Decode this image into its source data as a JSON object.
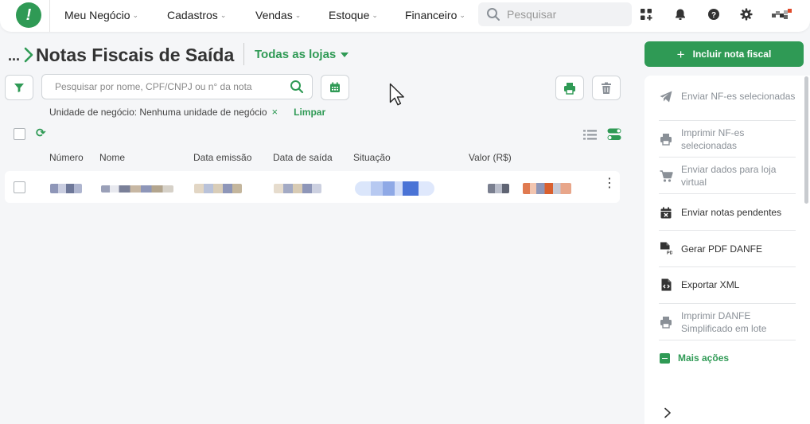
{
  "nav": {
    "items": [
      {
        "label": "Meu Negócio"
      },
      {
        "label": "Cadastros"
      },
      {
        "label": "Vendas"
      },
      {
        "label": "Estoque"
      },
      {
        "label": "Financeiro"
      }
    ],
    "search_placeholder": "Pesquisar"
  },
  "page": {
    "breadcrumb_dots": "...",
    "title": "Notas Fiscais de Saída",
    "store_select": "Todas as lojas"
  },
  "filters": {
    "search_placeholder": "Pesquisar por nome, CPF/CNPJ ou n° da nota",
    "chip_text": "Unidade de negócio: Nenhuma unidade de negócio",
    "chip_remove": "×",
    "clear_label": "Limpar"
  },
  "table": {
    "columns": [
      "Número",
      "Nome",
      "Data emissão",
      "Data de saída",
      "Situação",
      "Valor (R$)"
    ]
  },
  "actions": {
    "include_label": "Incluir nota fiscal",
    "include_plus": "+",
    "items": [
      {
        "label": "Enviar NF-es selecionadas",
        "icon": "send-icon",
        "enabled": false
      },
      {
        "label": "Imprimir NF-es selecionadas",
        "icon": "printer-icon",
        "enabled": false
      },
      {
        "label": "Enviar dados para loja virtual",
        "icon": "cart-icon",
        "enabled": false
      },
      {
        "label": "Enviar notas pendentes",
        "icon": "calendar-x-icon",
        "enabled": true
      },
      {
        "label": "Gerar PDF DANFE",
        "icon": "pdf-file-icon",
        "enabled": true
      },
      {
        "label": "Exportar XML",
        "icon": "code-file-icon",
        "enabled": true
      },
      {
        "label": "Imprimir DANFE Simplificado em lote",
        "icon": "printer-icon",
        "enabled": false
      }
    ],
    "more_label": "Mais ações"
  },
  "colors": {
    "brand_green": "#2f9a55",
    "disabled_text": "#8a9097"
  }
}
